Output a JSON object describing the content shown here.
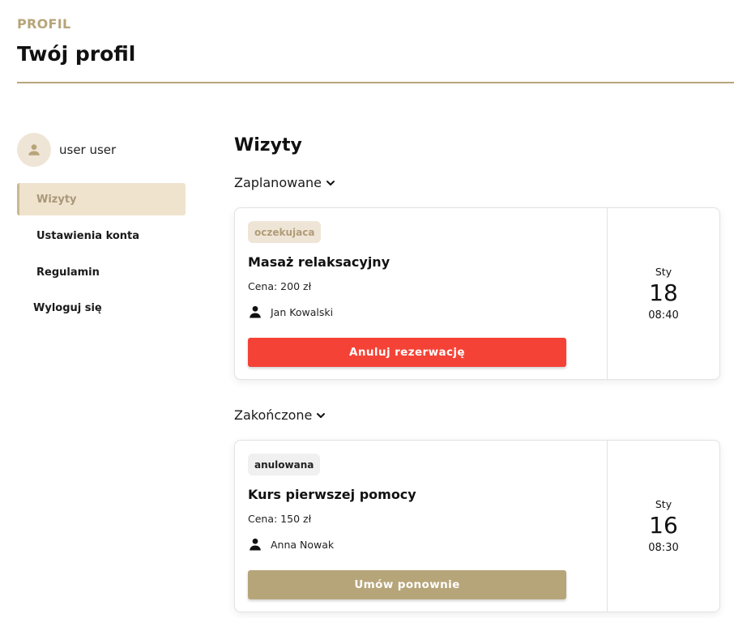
{
  "header": {
    "eyebrow": "PROFIL",
    "title": "Twój profil"
  },
  "sidebar": {
    "user_name": "user user",
    "items": [
      {
        "label": "Wizyty",
        "active": true
      },
      {
        "label": "Ustawienia konta",
        "active": false
      },
      {
        "label": "Regulamin",
        "active": false
      },
      {
        "label": "Wyloguj się",
        "active": false
      }
    ]
  },
  "main": {
    "title": "Wizyty",
    "sections": [
      {
        "label": "Zaplanowane",
        "appointment": {
          "status": "oczekujaca",
          "service": "Masaż relaksacyjny",
          "price": "Cena: 200 zł",
          "specialist": "Jan Kowalski",
          "action_label": "Anuluj rezerwację",
          "month": "Sty",
          "day": "18",
          "time": "08:40"
        }
      },
      {
        "label": "Zakończone",
        "appointment": {
          "status": "anulowana",
          "service": "Kurs pierwszej pomocy",
          "price": "Cena: 150 zł",
          "specialist": "Anna Nowak",
          "action_label": "Umów ponownie",
          "month": "Sty",
          "day": "16",
          "time": "08:30"
        }
      }
    ]
  },
  "colors": {
    "accent": "#b7a57a",
    "accent_light": "#efe5d6",
    "danger": "#f44336"
  },
  "icons": {
    "avatar": "user-avatar-icon",
    "chevron": "chevron-down-icon",
    "person": "person-icon"
  }
}
